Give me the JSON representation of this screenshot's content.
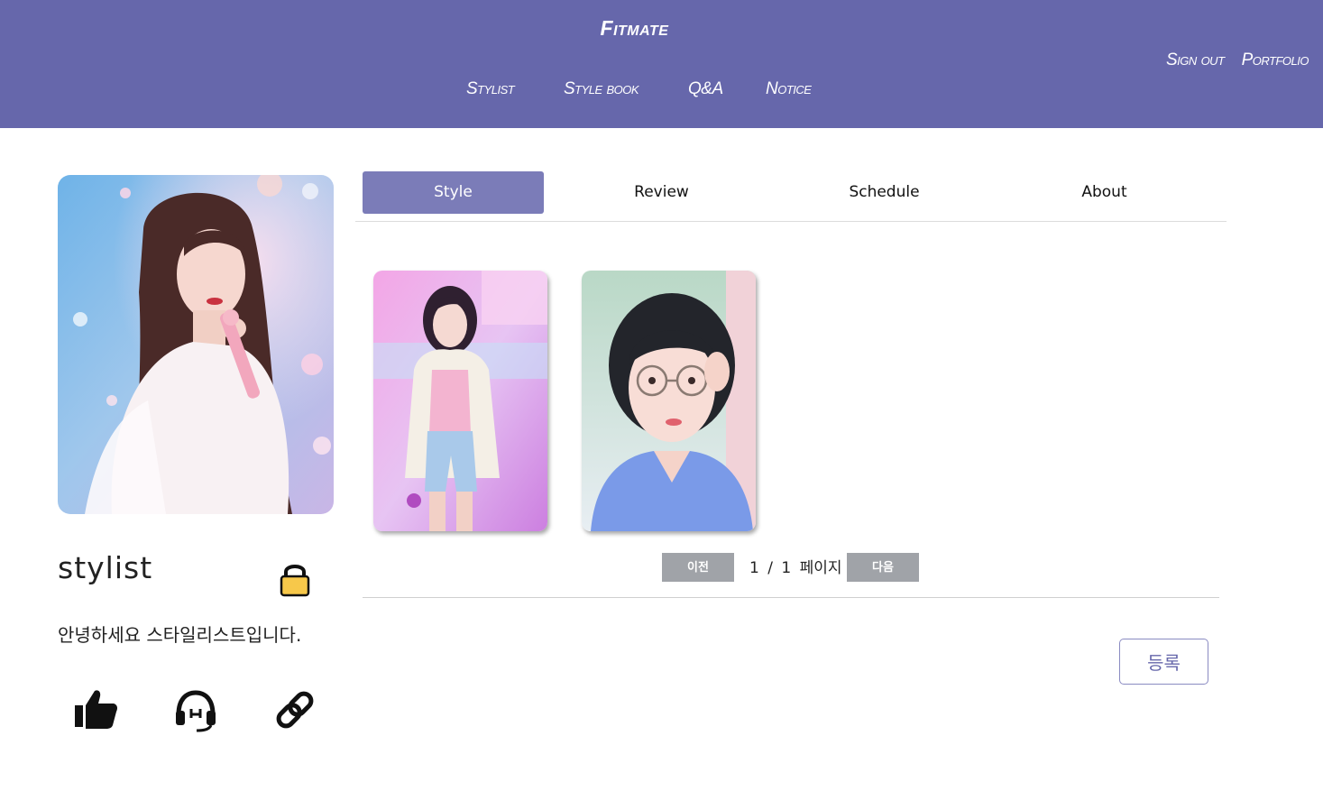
{
  "header": {
    "brand": "Fitmate",
    "nav": [
      "Stylist",
      "Style book",
      "Q&A",
      "Notice"
    ],
    "top_links": [
      "Sign out",
      "Portfolio"
    ],
    "bg_color": "#6667ab"
  },
  "profile": {
    "name": "stylist",
    "intro": "안녕하세요 스타일리스트입니다.",
    "icons": [
      "lock-icon",
      "thumbs-up-icon",
      "headset-icon",
      "link-icon"
    ]
  },
  "tabs": {
    "items": [
      "Style",
      "Review",
      "Schedule",
      "About"
    ],
    "active": "Style",
    "active_color": "#7b7cb8"
  },
  "gallery": {
    "items": [
      "style-photo-1",
      "style-photo-2"
    ]
  },
  "pagination": {
    "prev_label": "이전",
    "next_label": "다음",
    "current": "1",
    "separator": "/",
    "total": "1",
    "unit": "페이지"
  },
  "actions": {
    "register_label": "등록"
  }
}
